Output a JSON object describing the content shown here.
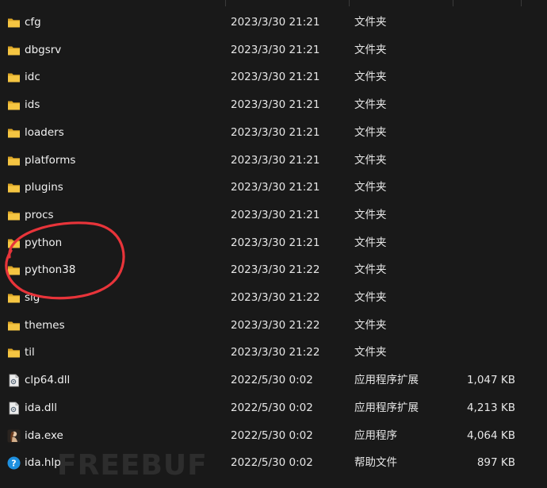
{
  "rows": [
    {
      "name": "cfg",
      "date": "2023/3/30 21:21",
      "type": "文件夹",
      "size": "",
      "icon": "folder-icon"
    },
    {
      "name": "dbgsrv",
      "date": "2023/3/30 21:21",
      "type": "文件夹",
      "size": "",
      "icon": "folder-icon"
    },
    {
      "name": "idc",
      "date": "2023/3/30 21:21",
      "type": "文件夹",
      "size": "",
      "icon": "folder-icon"
    },
    {
      "name": "ids",
      "date": "2023/3/30 21:21",
      "type": "文件夹",
      "size": "",
      "icon": "folder-icon"
    },
    {
      "name": "loaders",
      "date": "2023/3/30 21:21",
      "type": "文件夹",
      "size": "",
      "icon": "folder-icon"
    },
    {
      "name": "platforms",
      "date": "2023/3/30 21:21",
      "type": "文件夹",
      "size": "",
      "icon": "folder-icon"
    },
    {
      "name": "plugins",
      "date": "2023/3/30 21:21",
      "type": "文件夹",
      "size": "",
      "icon": "folder-icon"
    },
    {
      "name": "procs",
      "date": "2023/3/30 21:21",
      "type": "文件夹",
      "size": "",
      "icon": "folder-icon"
    },
    {
      "name": "python",
      "date": "2023/3/30 21:21",
      "type": "文件夹",
      "size": "",
      "icon": "folder-icon"
    },
    {
      "name": "python38",
      "date": "2023/3/30 21:22",
      "type": "文件夹",
      "size": "",
      "icon": "folder-icon"
    },
    {
      "name": "sig",
      "date": "2023/3/30 21:22",
      "type": "文件夹",
      "size": "",
      "icon": "folder-icon"
    },
    {
      "name": "themes",
      "date": "2023/3/30 21:22",
      "type": "文件夹",
      "size": "",
      "icon": "folder-icon"
    },
    {
      "name": "til",
      "date": "2023/3/30 21:22",
      "type": "文件夹",
      "size": "",
      "icon": "folder-icon"
    },
    {
      "name": "clp64.dll",
      "date": "2022/5/30 0:02",
      "type": "应用程序扩展",
      "size": "1,047 KB",
      "icon": "dll-file-icon"
    },
    {
      "name": "ida.dll",
      "date": "2022/5/30 0:02",
      "type": "应用程序扩展",
      "size": "4,213 KB",
      "icon": "dll-file-icon"
    },
    {
      "name": "ida.exe",
      "date": "2022/5/30 0:02",
      "type": "应用程序",
      "size": "4,064 KB",
      "icon": "ida-app-icon"
    },
    {
      "name": "ida.hlp",
      "date": "2022/5/30 0:02",
      "type": "帮助文件",
      "size": "897 KB",
      "icon": "help-file-icon"
    }
  ],
  "watermark": "FREEBUF",
  "colors": {
    "background": "#191919",
    "folder": "#f5c542",
    "annotation": "#e8343a",
    "help_icon": "#1e90e0"
  }
}
